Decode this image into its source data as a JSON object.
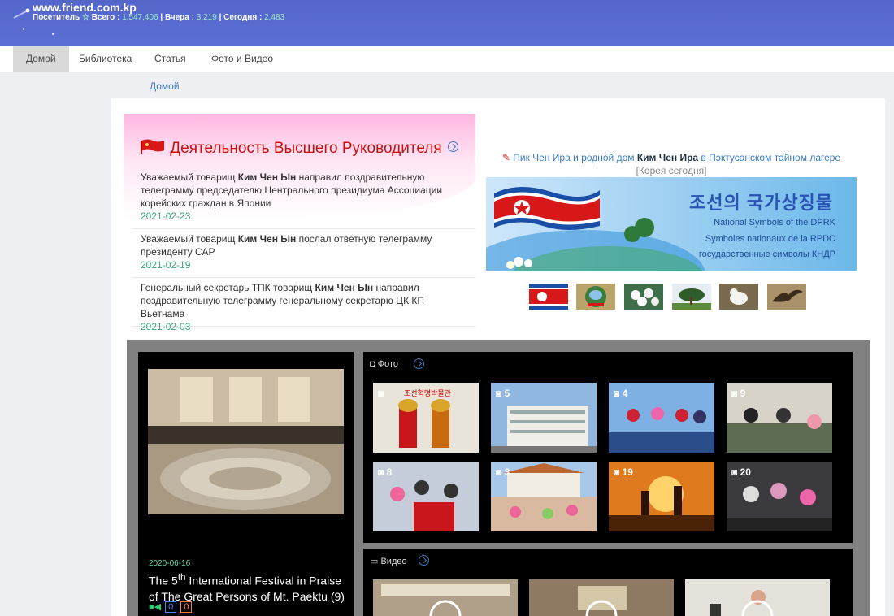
{
  "header": {
    "site": "www.friend.com.kp",
    "visitor_label": "Посетитель",
    "total_label": "Всего :",
    "total": "1,547,406",
    "yesterday_label": "Вчера :",
    "yesterday": "3,219",
    "today_label": "Сегодня :",
    "today": "2,483",
    "sep": "|"
  },
  "nav": [
    "Домой",
    "Библиотека",
    "Статья",
    "Фото и Видео"
  ],
  "breadcrumb": "Домой",
  "leader": {
    "title": "Деятельность Высшего Руководителя",
    "items": [
      {
        "pre": "Уважаемый товарищ ",
        "bold": "Ким Чен Ын",
        "post": " направил поздравительную телеграмму председателю Центрального президиума Ассоциации корейских граждан в Японии",
        "date": "2021-02-23"
      },
      {
        "pre": "Уважаемый товарищ ",
        "bold": "Ким Чен Ын",
        "post": " послал ответную телеграмму президенту САР",
        "date": "2021-02-19"
      },
      {
        "pre": "Генеральный секретарь ТПК товарищ ",
        "bold": "Ким Чен Ын",
        "post": " направил поздравительную телеграмму генеральному секретарю ЦК КП Вьетнама",
        "date": "2021-02-03"
      }
    ]
  },
  "feature": {
    "pre": "Пик Чен Ира и родной дом ",
    "bold": "Ким Чен Ира",
    "post": " в Пэктусанском тайном лагере ",
    "source": "[Корея сегодня]"
  },
  "symbols_banner": {
    "korean": "조선의 국가상징물",
    "en": "National Symbols of the DPRK",
    "fr": "Symboles nationaux de la RPDC",
    "ru": "государственные символы КНДР"
  },
  "video_lead": {
    "date": "2020-06-16",
    "title_pre": "The 5",
    "title_sup": "th",
    "title_post": " International Festival in Praise of The Great Persons of Mt. Paektu (9)",
    "count_a": "0",
    "count_b": "0"
  },
  "photo": {
    "label": "Фото",
    "counts": [
      "",
      "5",
      "4",
      "9",
      "8",
      "3",
      "19",
      "20"
    ],
    "caption_first": "조선혁명박물관"
  },
  "video": {
    "label": "Видео"
  },
  "colors": {
    "header": "#5466c9",
    "accent_red": "#c81010",
    "date_green": "#3aa87a",
    "link": "#3a7bbf"
  }
}
